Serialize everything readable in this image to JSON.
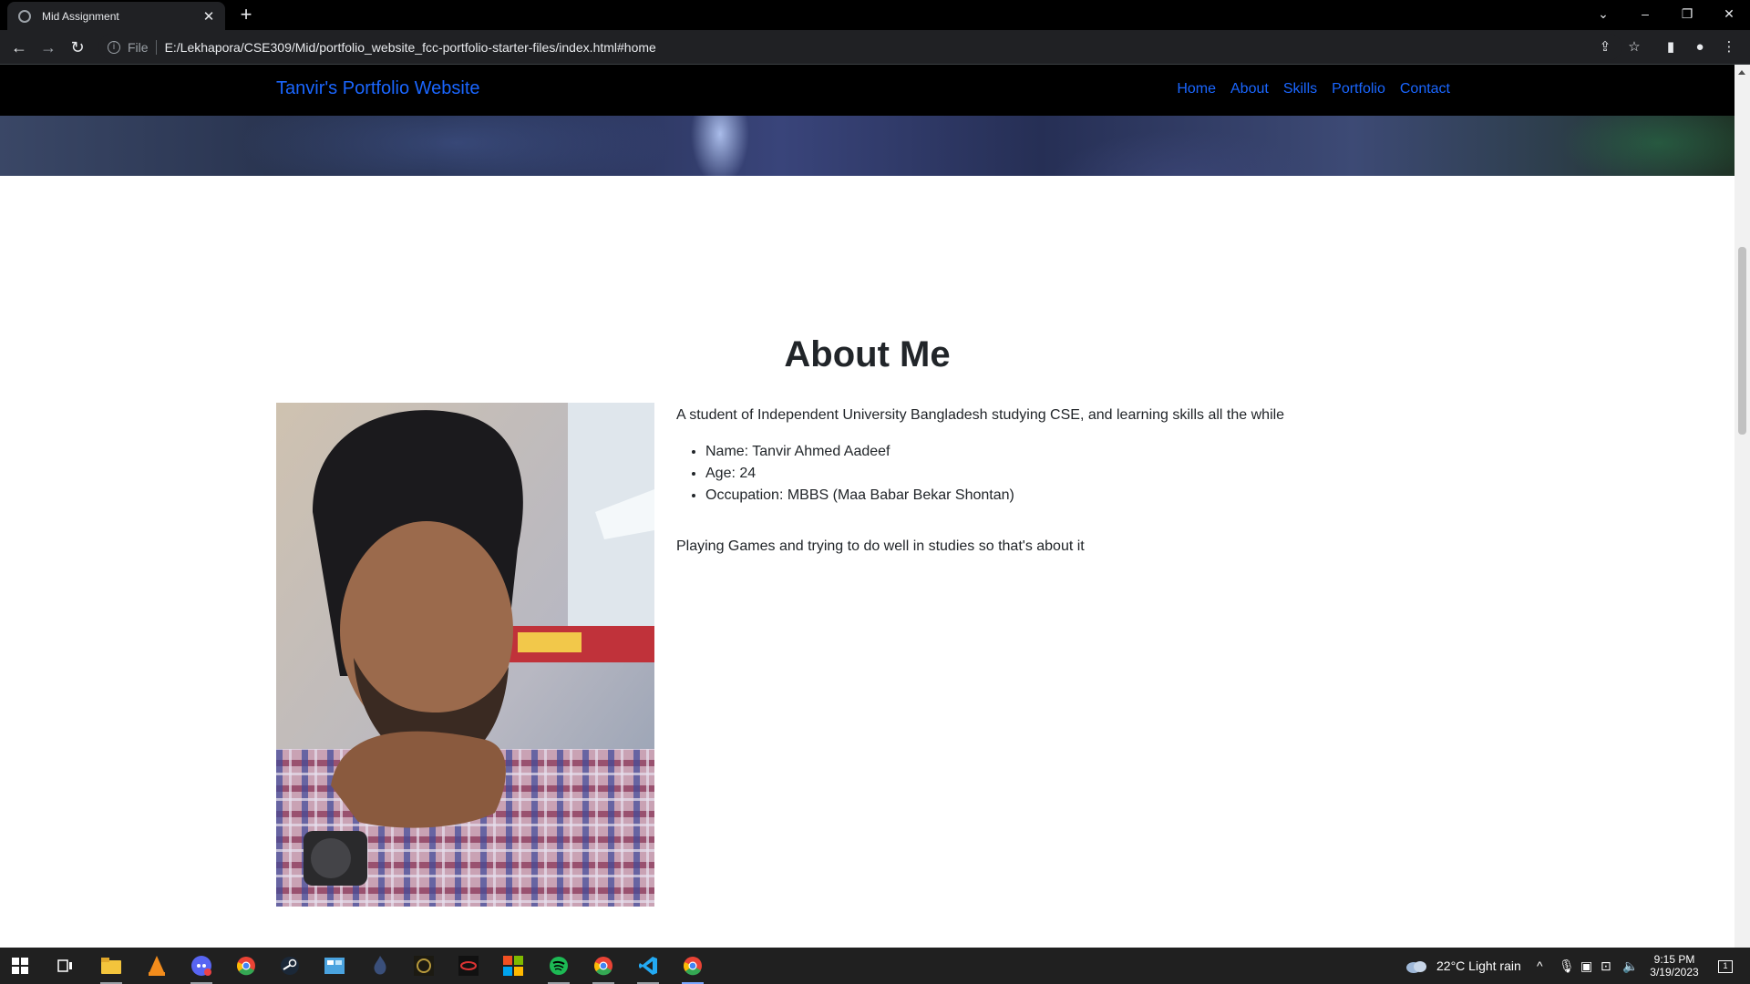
{
  "browser": {
    "tab_title": "Mid Assignment",
    "tab_close": "✕",
    "new_tab": "+",
    "file_label": "File",
    "url": "E:/Lekhapora/CSE309/Mid/portfolio_website_fcc-portfolio-starter-files/index.html#home"
  },
  "site": {
    "brand": "Tanvir's Portfolio Website",
    "nav": [
      "Home",
      "About",
      "Skills",
      "Portfolio",
      "Contact"
    ]
  },
  "about": {
    "title": "About Me",
    "intro": "A student of Independent University Bangladesh studying CSE, and learning skills all the while",
    "details": [
      "Name: Tanvir Ahmed Aadeef",
      "Age: 24",
      "Occupation: MBBS (Maa Babar Bekar Shontan)"
    ],
    "hobbies": "Playing Games and trying to do well in studies so that's about it"
  },
  "taskbar": {
    "weather": "22°C  Light rain",
    "time": "9:15 PM",
    "date": "3/19/2023",
    "notifications": "1"
  },
  "colors": {
    "link_blue": "#1a66ff",
    "text": "#212529",
    "chrome_dark": "#202124"
  }
}
